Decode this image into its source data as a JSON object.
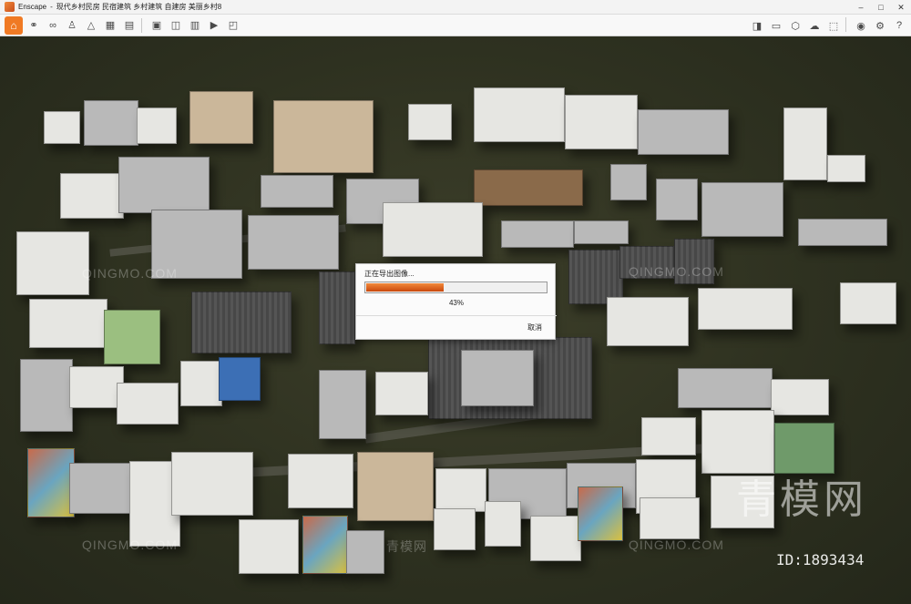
{
  "window": {
    "app_name": "Enscape",
    "title": "现代乡村民房 民宿建筑 乡村建筑 自建房 美丽乡村8",
    "min_symbol": "–",
    "max_symbol": "□",
    "close_symbol": "✕"
  },
  "toolbar": {
    "left_icons": [
      "home-icon",
      "connect-icon",
      "binoculars-icon",
      "walk-icon",
      "flight-icon",
      "export-image-icon",
      "export-batch-icon",
      "export-panorama-icon",
      "export-video-icon",
      "export-web-icon",
      "export-exe-icon"
    ],
    "right_icons": [
      "sky-icon",
      "atmosphere-icon",
      "asset-library-icon",
      "material-icon",
      "capture-icon",
      "visual-settings-icon",
      "settings-icon",
      "help-icon"
    ]
  },
  "dialog": {
    "title": "正在导出图像...",
    "progress_percent": 43,
    "progress_text": "43%",
    "cancel_label": "取消",
    "accent_color": "#e0651a"
  },
  "watermarks": {
    "small_text": "QINGMO.COM",
    "small_cn": "青模网",
    "big_text": "青模网",
    "id_text": "ID:1893434"
  }
}
